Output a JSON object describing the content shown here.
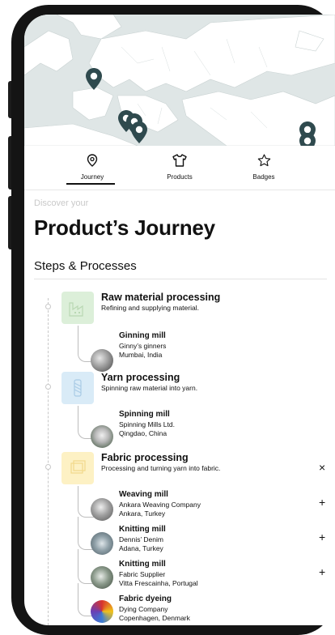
{
  "tabs": [
    {
      "label": "Journey",
      "icon": "map-pin-icon",
      "active": true
    },
    {
      "label": "Products",
      "icon": "tshirt-icon",
      "active": false
    },
    {
      "label": "Badges",
      "icon": "star-icon",
      "active": false
    }
  ],
  "header": {
    "eyebrow": "Discover your",
    "title": "Product’s Journey"
  },
  "section_title": "Steps & Processes",
  "colors": {
    "pin": "#2f4a4e",
    "raw_material": "#dcefd9",
    "yarn": "#d9ebf7",
    "fabric": "#fdf1c4",
    "map_land": "#ffffff",
    "map_sea": "#dfe6e6"
  },
  "steps": [
    {
      "title": "Raw material processing",
      "description": "Refining and supplying material.",
      "icon": "factory-icon",
      "subitems": [
        {
          "name": "Ginning mill",
          "company": "Ginny’s ginners",
          "location": "Mumbai, India",
          "action": ""
        }
      ]
    },
    {
      "title": "Yarn processing",
      "description": "Spinning raw material into yarn.",
      "icon": "yarn-spool-icon",
      "subitems": [
        {
          "name": "Spinning mill",
          "company": "Spinning Mills Ltd.",
          "location": "Qingdao, China",
          "action": ""
        }
      ]
    },
    {
      "title": "Fabric processing",
      "description": "Processing and turning yarn into fabric.",
      "icon": "fabric-icon",
      "action": "×",
      "subitems": [
        {
          "name": "Weaving mill",
          "company": "Ankara Weaving Company",
          "location": "Ankara, Turkey",
          "action": "+"
        },
        {
          "name": "Knitting mill",
          "company": "Dennis’ Denim",
          "location": "Adana, Turkey",
          "action": "+"
        },
        {
          "name": "Knitting mill",
          "company": "Fabric Supplier",
          "location": "Vitta Frescainha, Portugal",
          "action": "+"
        },
        {
          "name": "Fabric dyeing",
          "company": "Dying Company",
          "location": "Copenhagen, Denmark",
          "action": ""
        }
      ]
    }
  ]
}
